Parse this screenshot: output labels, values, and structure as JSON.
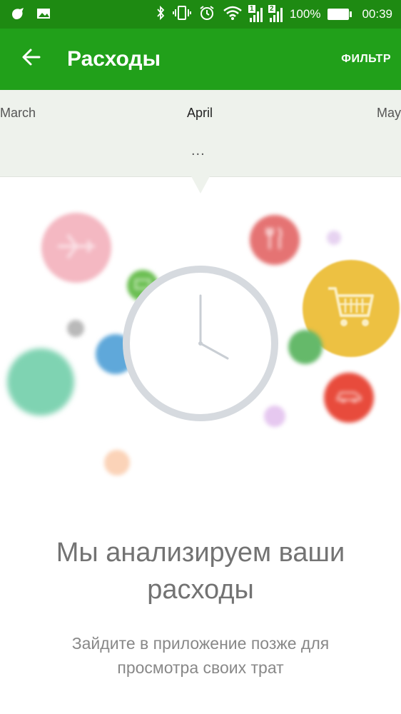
{
  "status_bar": {
    "battery_text": "100%",
    "time": "00:39",
    "sim1_label": "1",
    "sim2_label": "2"
  },
  "app_bar": {
    "title": "Расходы",
    "filter_label": "ФИЛЬТР"
  },
  "month_selector": {
    "previous": "March",
    "current": "April",
    "next": "May",
    "more": "..."
  },
  "message": {
    "headline_line1": "Мы анализируем ваши",
    "headline_line2": "расходы",
    "subtext_line1": "Зайдите в приложение позже для",
    "subtext_line2": "просмотра своих трат"
  },
  "colors": {
    "status_bar": "#1e8a12",
    "app_bar": "#21a01a",
    "month_bg": "#eef2ec",
    "travel": "#f4b8c2",
    "food": "#e57373",
    "shopping": "#edc142",
    "car": "#e84b3c",
    "green": "#65b96a",
    "blue": "#5fa8da",
    "teal": "#7fd3b2"
  }
}
